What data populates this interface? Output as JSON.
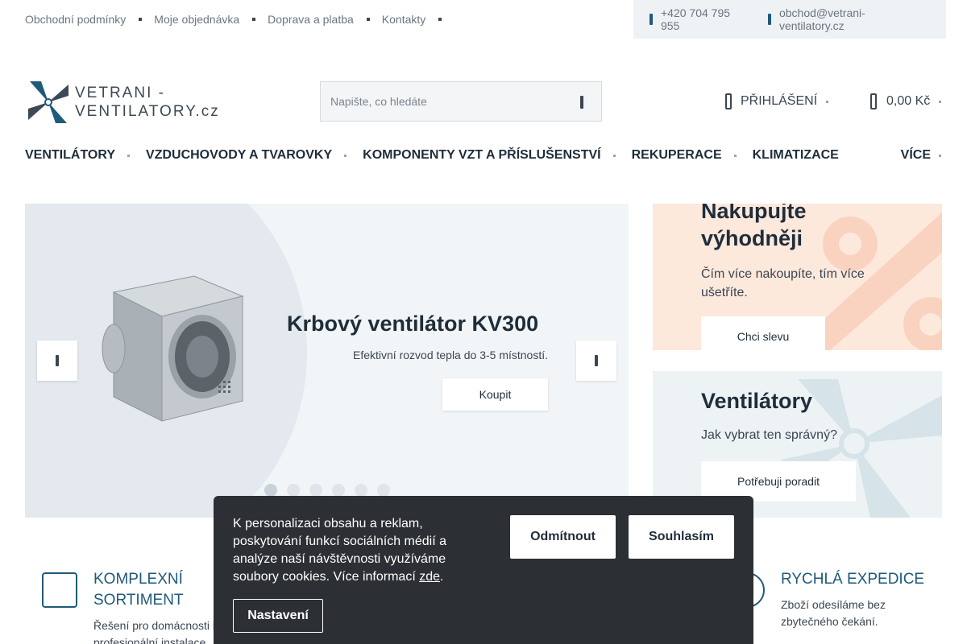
{
  "topbar": {
    "links": [
      "Obchodní podmínky",
      "Moje objednávka",
      "Doprava a platba",
      "Kontakty"
    ],
    "phone": "+420 704 795 955",
    "email": "obchod@vetrani-ventilatory.cz"
  },
  "header": {
    "logo_line1": "VETRANI -",
    "logo_line2": "VENTILATORY.cz",
    "search_placeholder": "Napište, co hledáte",
    "login_label": "PŘIHLÁŠENÍ",
    "cart_total": "0,00 Kč"
  },
  "nav": {
    "items": [
      "VENTILÁTORY",
      "VZDUCHOVODY A TVAROVKY",
      "KOMPONENTY VZT A PŘÍSLUŠENSTVÍ",
      "REKUPERACE",
      "KLIMATIZACE"
    ],
    "more_label": "VÍCE"
  },
  "hero": {
    "title": "Krbový ventilátor KV300",
    "subtitle": "Efektivní rozvod tepla do 3-5 místností.",
    "button_label": "Koupit",
    "slides_count": 6,
    "active_slide": 1
  },
  "promo": {
    "card1": {
      "title_line1": "Nakupujte",
      "title_line2": "výhodněji",
      "text_line1": "Čím více nakoupíte, tím více",
      "text_line2": "ušetříte.",
      "button_label": "Chci slevu"
    },
    "card2": {
      "title": "Ventilátory",
      "text": "Jak vybrat ten správný?",
      "button_label": "Potřebuji poradit"
    }
  },
  "features": {
    "f1": {
      "title_line1": "KOMPLEXNÍ",
      "title_line2": "SORTIMENT",
      "text_line1": "Řešení pro domácnosti i",
      "text_line2": "profesionální instalace."
    },
    "f2": {
      "title": "RYCHLÁ EXPEDICE",
      "text_line1": "Zboží odesíláme bez",
      "text_line2": "zbytečného čekání."
    }
  },
  "cookie": {
    "text_line1": "K personalizaci obsahu a reklam,",
    "text_line2": "poskytování funkcí sociálních médií a",
    "text_line3": "analýze naší návštěvnosti využíváme",
    "text_line4": "soubory cookies. Více informací",
    "link_label": "zde",
    "period": ".",
    "reject_label": "Odmítnout",
    "accept_label": "Souhlasím",
    "settings_label": "Nastavení"
  },
  "colors": {
    "brand": "#1e5a7a",
    "promo_peach": "#fde8dc",
    "promo_blue": "#edf2f5",
    "cookie_bg": "#2c2f33"
  }
}
